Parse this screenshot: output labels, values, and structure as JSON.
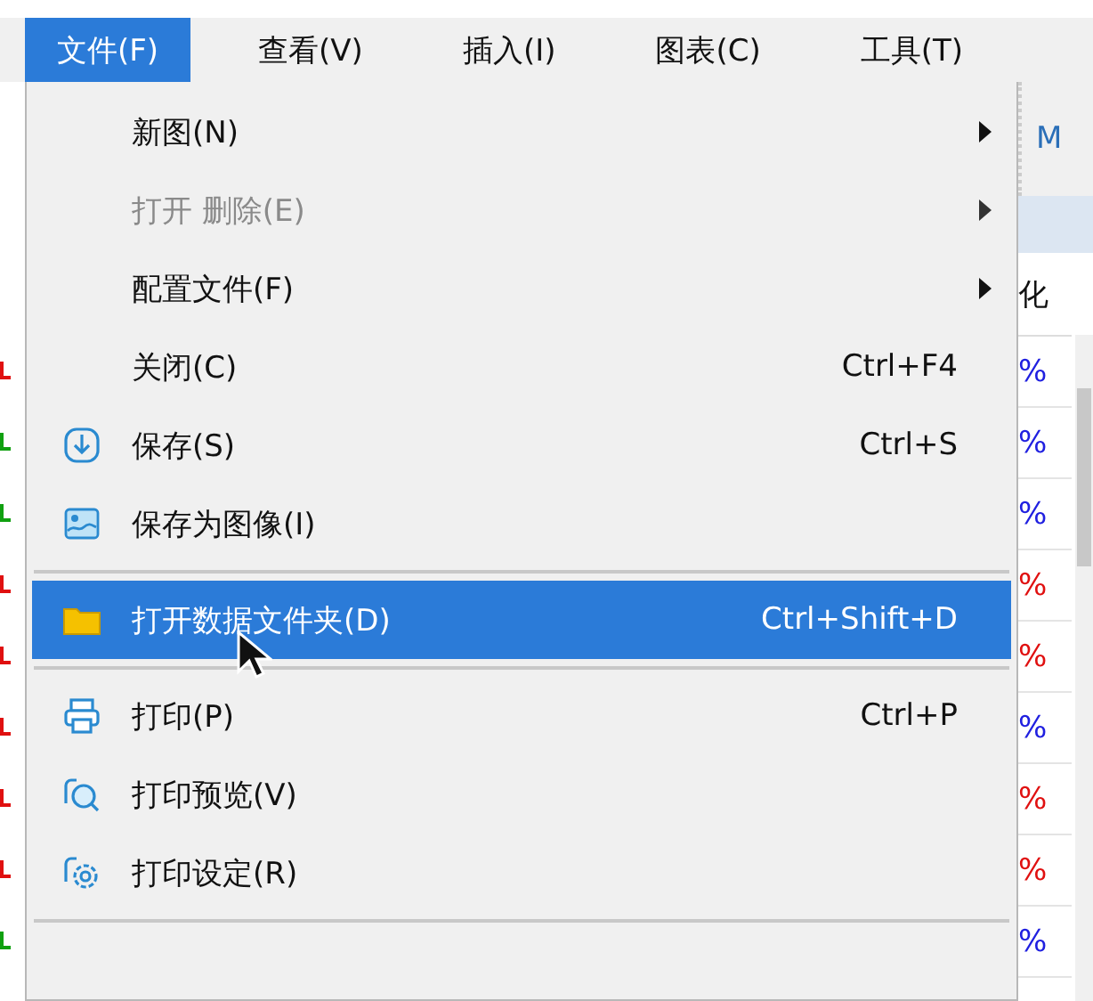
{
  "menubar": [
    {
      "label": "文件(F)",
      "selected": true
    },
    {
      "label": "查看(V)",
      "selected": false
    },
    {
      "label": "插入(I)",
      "selected": false
    },
    {
      "label": "图表(C)",
      "selected": false
    },
    {
      "label": "工具(T)",
      "selected": false
    }
  ],
  "file_menu": [
    {
      "kind": "item",
      "label": "新图(N)",
      "submenu": true,
      "disabled": false,
      "selected": false
    },
    {
      "kind": "item",
      "label": "打开 删除(E)",
      "submenu": true,
      "disabled": true,
      "selected": false
    },
    {
      "kind": "item",
      "label": "配置文件(F)",
      "submenu": true,
      "disabled": false,
      "selected": false
    },
    {
      "kind": "item",
      "label": "关闭(C)",
      "shortcut": "Ctrl+F4",
      "submenu": false,
      "disabled": false,
      "selected": false
    },
    {
      "kind": "item",
      "label": "保存(S)",
      "shortcut": "Ctrl+S",
      "submenu": false,
      "disabled": false,
      "selected": false
    },
    {
      "kind": "item",
      "label": "保存为图像(I)",
      "submenu": false,
      "disabled": false,
      "selected": false
    },
    {
      "kind": "separator"
    },
    {
      "kind": "item",
      "label": "打开数据文件夹(D)",
      "shortcut": "Ctrl+Shift+D",
      "submenu": false,
      "disabled": false,
      "selected": true
    },
    {
      "kind": "separator"
    },
    {
      "kind": "item",
      "label": "打印(P)",
      "shortcut": "Ctrl+P",
      "submenu": false,
      "disabled": false,
      "selected": false
    },
    {
      "kind": "item",
      "label": "打印预览(V)",
      "submenu": false,
      "disabled": false,
      "selected": false
    },
    {
      "kind": "item",
      "label": "打印设定(R)",
      "submenu": false,
      "disabled": false,
      "selected": false
    },
    {
      "kind": "separator"
    }
  ],
  "right_panel": {
    "toolbar_label": "M",
    "column_header": "化",
    "cells": [
      {
        "text": "%",
        "color": "#2020e0"
      },
      {
        "text": "%",
        "color": "#2020e0"
      },
      {
        "text": "%",
        "color": "#2020e0"
      },
      {
        "text": "%",
        "color": "#e01010"
      },
      {
        "text": "%",
        "color": "#e01010"
      },
      {
        "text": "%",
        "color": "#2020e0"
      },
      {
        "text": "%",
        "color": "#e01010"
      },
      {
        "text": "%",
        "color": "#e01010"
      },
      {
        "text": "%",
        "color": "#2020e0"
      }
    ]
  },
  "left_marks": [
    {
      "color": "#e01010"
    },
    {
      "color": "#10a010"
    },
    {
      "color": "#10a010"
    },
    {
      "color": "#e01010"
    },
    {
      "color": "#e01010"
    },
    {
      "color": "#e01010"
    },
    {
      "color": "#e01010"
    },
    {
      "color": "#e01010"
    },
    {
      "color": "#10a010"
    }
  ]
}
